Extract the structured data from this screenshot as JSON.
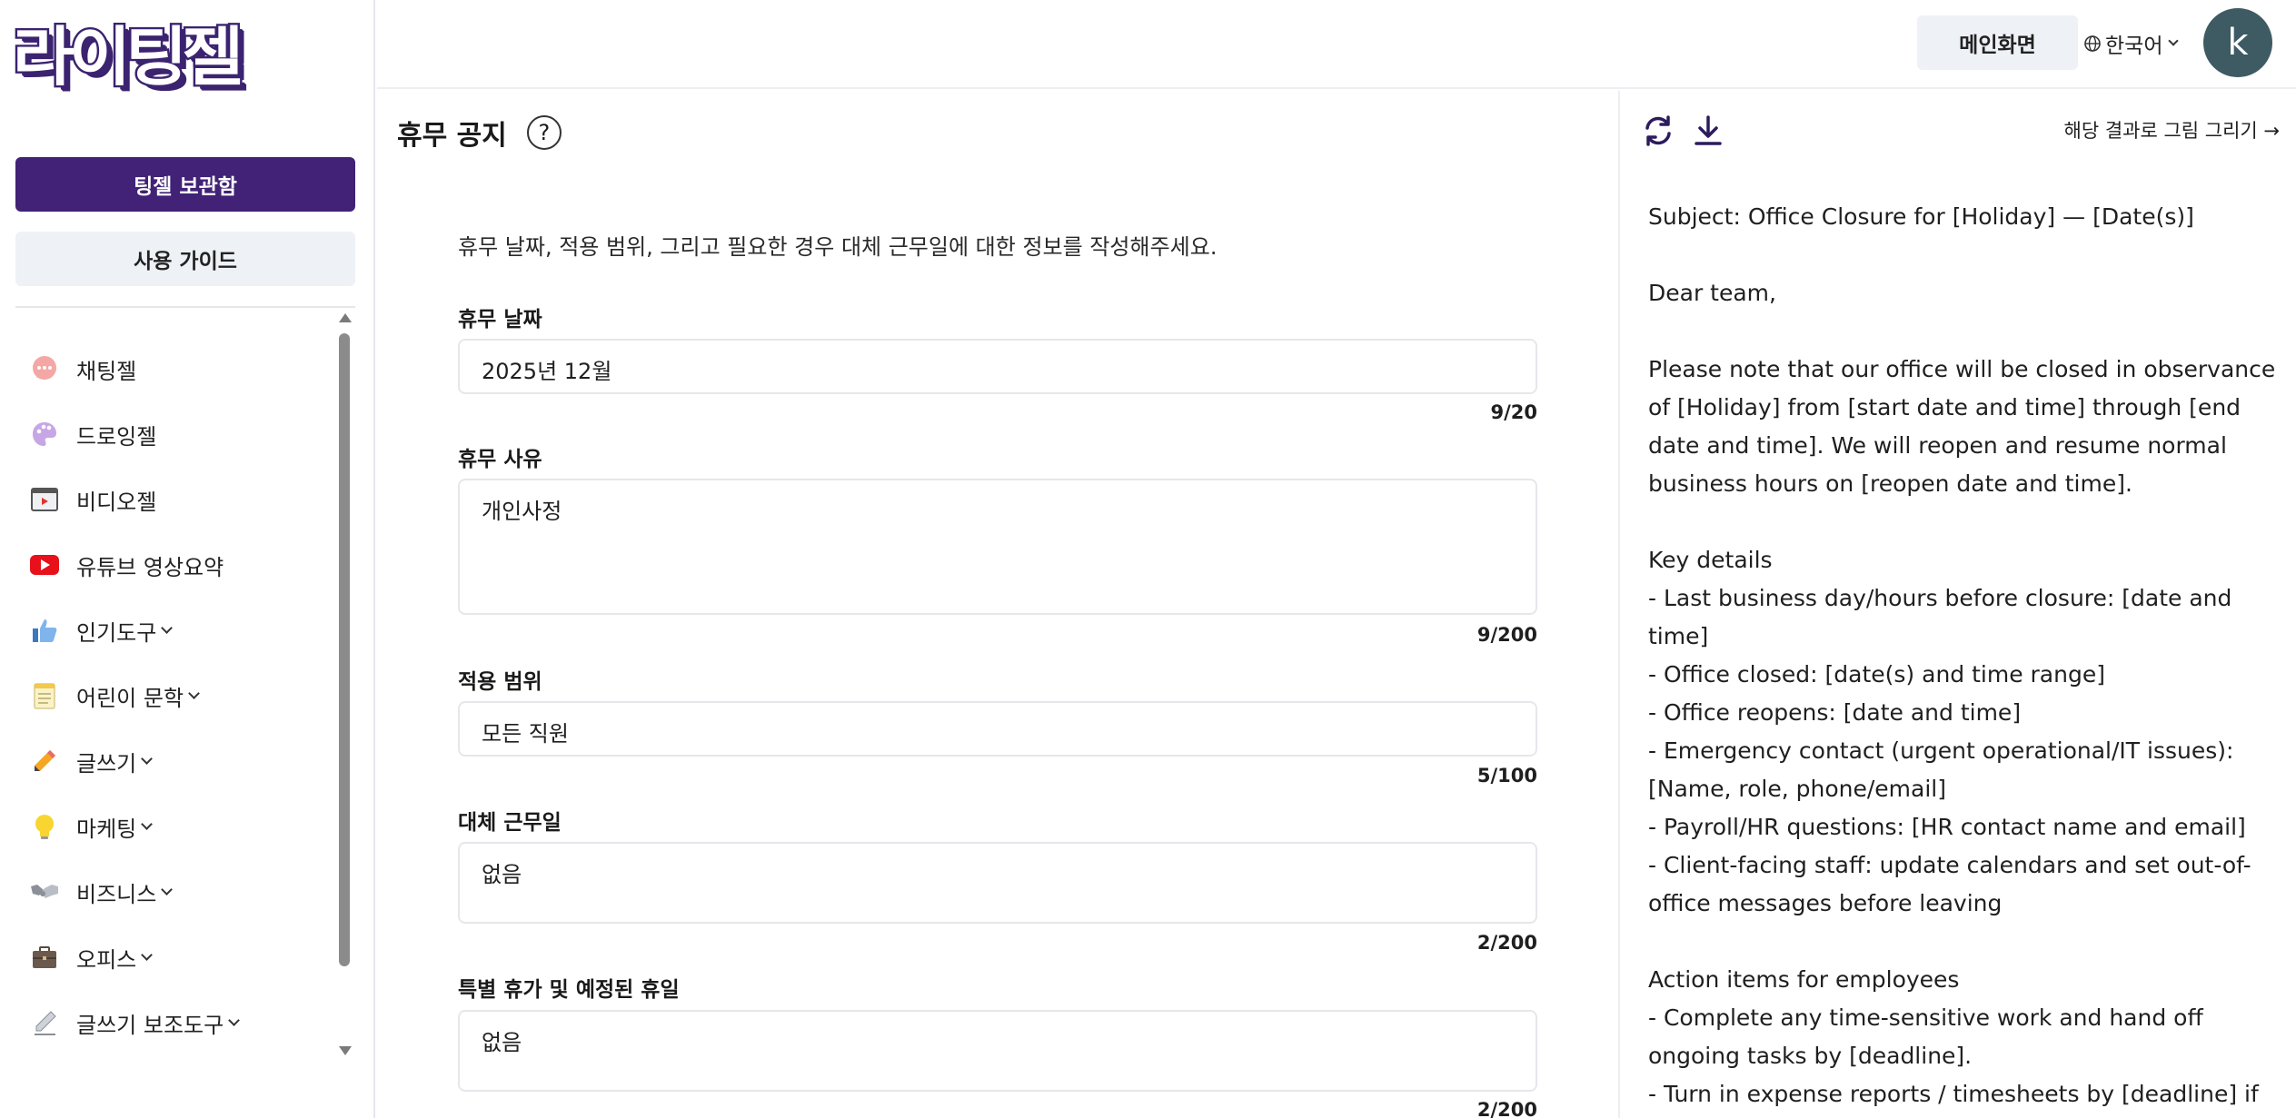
{
  "brand": {
    "logo_text": "라이팅젤"
  },
  "sidebar": {
    "archive_button": "팅젤 보관함",
    "guide_button": "사용 가이드",
    "items": [
      {
        "label": "채팅젤",
        "icon": "chat-bubble-icon",
        "has_submenu": false
      },
      {
        "label": "드로잉젤",
        "icon": "palette-icon",
        "has_submenu": false
      },
      {
        "label": "비디오젤",
        "icon": "video-player-icon",
        "has_submenu": false
      },
      {
        "label": "유튜브 영상요약",
        "icon": "youtube-icon",
        "has_submenu": false
      },
      {
        "label": "인기도구",
        "icon": "thumbs-up-icon",
        "has_submenu": true
      },
      {
        "label": "어린이 문학",
        "icon": "notepad-icon",
        "has_submenu": true
      },
      {
        "label": "글쓰기",
        "icon": "pencil-icon",
        "has_submenu": true
      },
      {
        "label": "마케팅",
        "icon": "lightbulb-icon",
        "has_submenu": true
      },
      {
        "label": "비즈니스",
        "icon": "handshake-icon",
        "has_submenu": true
      },
      {
        "label": "오피스",
        "icon": "briefcase-icon",
        "has_submenu": true
      },
      {
        "label": "글쓰기 보조도구",
        "icon": "pen-icon",
        "has_submenu": true
      }
    ]
  },
  "header": {
    "main_button": "메인화면",
    "language": "한국어",
    "avatar_initial": "k"
  },
  "form": {
    "title": "휴무 공지",
    "intro": "휴무 날짜, 적용 범위, 그리고 필요한 경우 대체 근무일에 대한 정보를 작성해주세요.",
    "fields": [
      {
        "label": "휴무 날짜",
        "value": "2025년 12월",
        "count": "9/20"
      },
      {
        "label": "휴무 사유",
        "value": "개인사정",
        "count": "9/200"
      },
      {
        "label": "적용 범위",
        "value": "모든 직원",
        "count": "5/100"
      },
      {
        "label": "대체 근무일",
        "value": "없음",
        "count": "2/200"
      },
      {
        "label": "특별 휴가 및 예정된 휴일",
        "value": "없음",
        "count": "2/200"
      }
    ]
  },
  "result": {
    "draw_link": "해당 결과로 그림 그리기 →",
    "lines": [
      "Subject: Office Closure for [Holiday] — [Date(s)]",
      "",
      "Dear team,",
      "",
      "Please note that our office will be closed in observance of [Holiday] from [start date and time] through [end date and time]. We will reopen and resume normal business hours on [reopen date and time].",
      "",
      "Key details",
      "- Last business day/hours before closure: [date and time]",
      "- Office closed: [date(s) and time range]",
      "- Office reopens: [date and time]",
      "- Emergency contact (urgent operational/IT issues): [Name, role, phone/email]",
      "- Payroll/HR questions: [HR contact name and email]",
      "- Client-facing staff: update calendars and set out-of-office messages before leaving",
      "",
      "Action items for employees",
      "- Complete any time-sensitive work and hand off ongoing tasks by [deadline].",
      "- Turn in expense reports / timesheets by [deadline] if needed for payroll."
    ]
  },
  "colors": {
    "brand_purple": "#412276",
    "light_button": "#eef1f6",
    "avatar_bg": "#3e5a63",
    "border": "#e6e7eb"
  }
}
